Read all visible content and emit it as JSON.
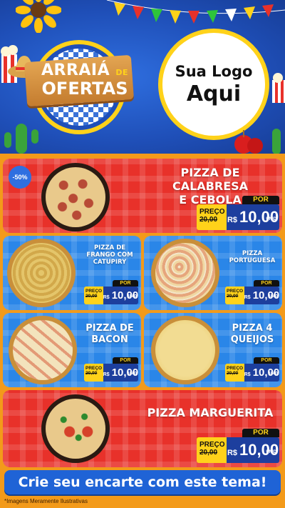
{
  "header": {
    "arraia_line1": "ARRAIÁ",
    "arraia_de": "DE",
    "arraia_line2": "OFERTAS",
    "logo_line1": "Sua Logo",
    "logo_line2": "Aqui"
  },
  "colors": {
    "red_card": "#e8312a",
    "blue_card": "#2a86e8",
    "price_blue": "#1d3f9e",
    "price_yellow": "#ffd21a",
    "background_orange": "#f39a1a"
  },
  "products": [
    {
      "title_line1": "PIZZA DE CALABRESA",
      "title_line2": "E CEBOLA",
      "badge": "-50%",
      "price_label": "PREÇO",
      "old_price": "20,00",
      "por": "POR",
      "currency": "R$",
      "new_price": "10,00",
      "unit": "UNID"
    },
    {
      "title_line1": "PIZZA DE",
      "title_line2": "FRANGO COM",
      "title_line3": "CATUPIRY",
      "price_label": "PREÇO",
      "old_price": "20,00",
      "por": "POR",
      "currency": "R$",
      "new_price": "10,00",
      "unit": "UNID"
    },
    {
      "title_line1": "PIZZA",
      "title_line2": "PORTUGUESA",
      "price_label": "PREÇO",
      "old_price": "20,00",
      "por": "POR",
      "currency": "R$",
      "new_price": "10,00",
      "unit": "UNID"
    },
    {
      "title_line1": "PIZZA DE",
      "title_line2": "BACON",
      "price_label": "PREÇO",
      "old_price": "20,00",
      "por": "POR",
      "currency": "R$",
      "new_price": "10,00",
      "unit": "UNID"
    },
    {
      "title_line1": "PIZZA 4",
      "title_line2": "QUEIJOS",
      "price_label": "PREÇO",
      "old_price": "20,00",
      "por": "POR",
      "currency": "R$",
      "new_price": "10,00",
      "unit": "UNID"
    },
    {
      "title_line1": "PIZZA MARGUERITA",
      "price_label": "PREÇO",
      "old_price": "20,00",
      "por": "POR",
      "currency": "R$",
      "new_price": "10,00",
      "unit": "UNID"
    }
  ],
  "cta": "Crie seu encarte com este tema!",
  "disclaimer": "*Imagens Meramente Ilustrativas"
}
